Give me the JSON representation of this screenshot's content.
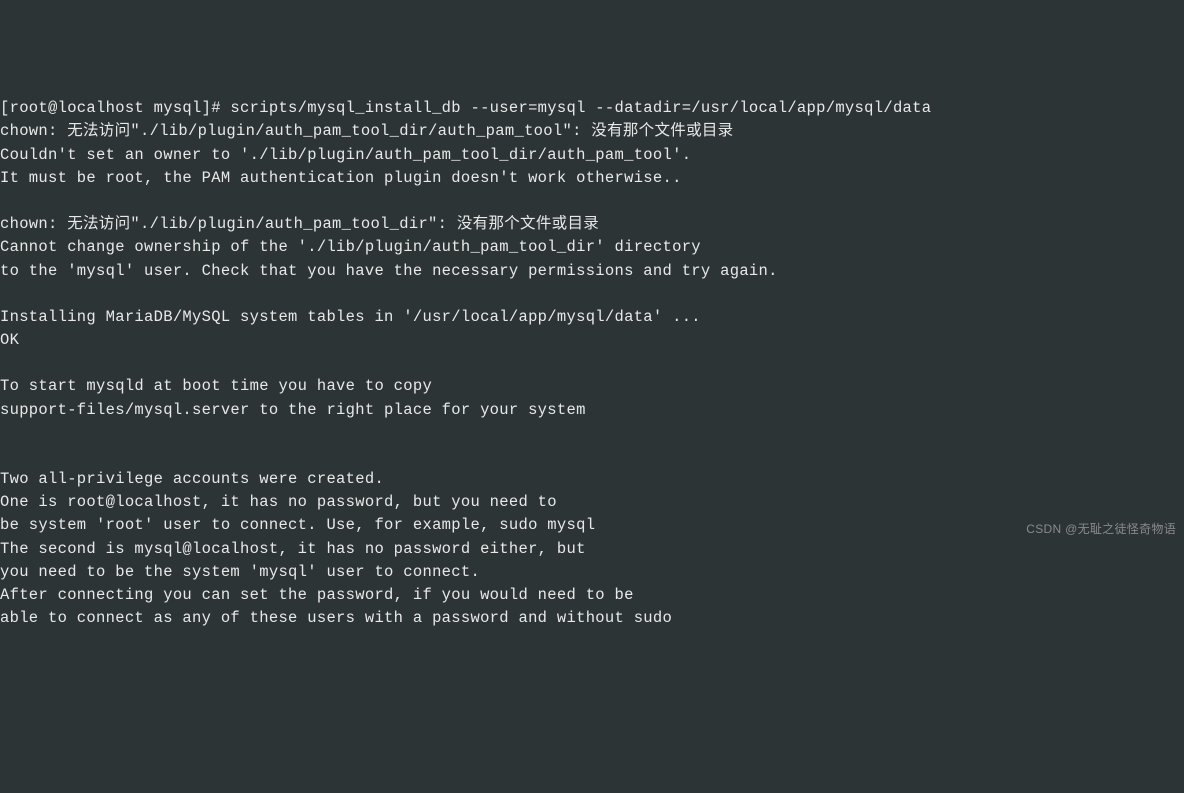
{
  "terminal": {
    "lines": [
      "[root@localhost mysql]# scripts/mysql_install_db --user=mysql --datadir=/usr/local/app/mysql/data",
      "chown: 无法访问\"./lib/plugin/auth_pam_tool_dir/auth_pam_tool\": 没有那个文件或目录",
      "Couldn't set an owner to './lib/plugin/auth_pam_tool_dir/auth_pam_tool'.",
      "It must be root, the PAM authentication plugin doesn't work otherwise..",
      "",
      "chown: 无法访问\"./lib/plugin/auth_pam_tool_dir\": 没有那个文件或目录",
      "Cannot change ownership of the './lib/plugin/auth_pam_tool_dir' directory",
      "to the 'mysql' user. Check that you have the necessary permissions and try again.",
      "",
      "Installing MariaDB/MySQL system tables in '/usr/local/app/mysql/data' ...",
      "OK",
      "",
      "To start mysqld at boot time you have to copy",
      "support-files/mysql.server to the right place for your system",
      "",
      "",
      "Two all-privilege accounts were created.",
      "One is root@localhost, it has no password, but you need to",
      "be system 'root' user to connect. Use, for example, sudo mysql",
      "The second is mysql@localhost, it has no password either, but",
      "you need to be the system 'mysql' user to connect.",
      "After connecting you can set the password, if you would need to be",
      "able to connect as any of these users with a password and without sudo"
    ]
  },
  "watermark": "CSDN @无耻之徒怪奇物语"
}
